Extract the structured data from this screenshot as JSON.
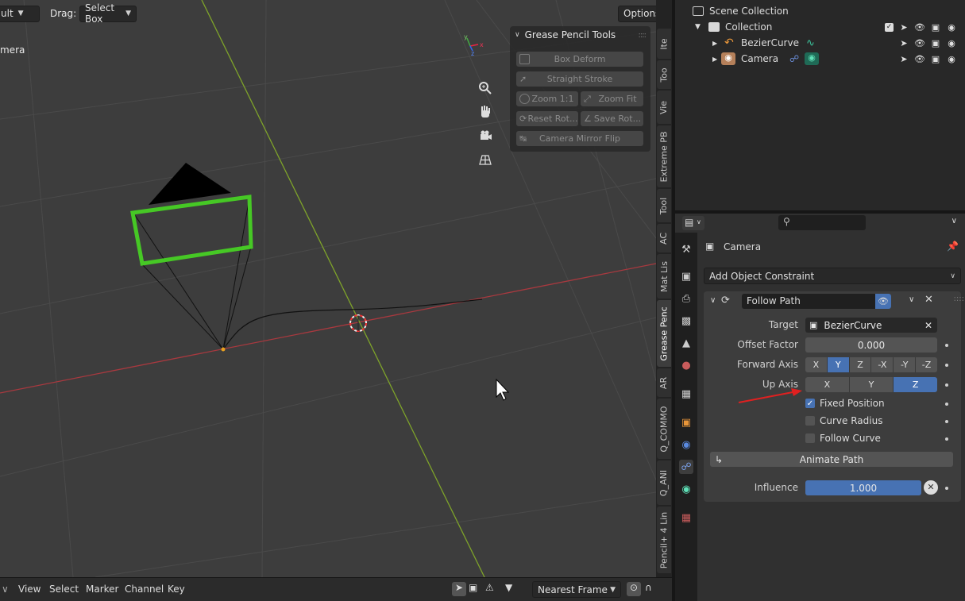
{
  "viewport": {
    "mode_dropdown": "ult",
    "drag_label": "Drag:",
    "drag_value": "Select Box",
    "options_label": "Options",
    "camera_label": "mera"
  },
  "gizmos": [
    "zoom-icon",
    "hand-icon",
    "camera-view-icon",
    "grid-icon"
  ],
  "grease_pencil_panel": {
    "title": "Grease Pencil Tools",
    "buttons": {
      "box_deform": "Box Deform",
      "straight_stroke": "Straight Stroke",
      "zoom_1_1": "Zoom 1:1",
      "zoom_fit": "Zoom Fit",
      "reset_rot": "Reset Rot...",
      "save_rot": "Save Rot...",
      "camera_mirror_flip": "Camera Mirror Flip"
    }
  },
  "sidebar_tabs": {
    "t1": "Ite",
    "t2": "Too",
    "t3": "Vie",
    "t4": "Extreme PB",
    "t5": "Tool",
    "t6": "AC",
    "t7": "Mat Lis",
    "t8": "Grease Penc",
    "t9": "AR",
    "t10": "Q_COMMO",
    "t11": "Q_ANI",
    "t12": "Pencil+ 4 Lin"
  },
  "timeline": {
    "view": "View",
    "select": "Select",
    "marker": "Marker",
    "channel": "Channel",
    "key": "Key",
    "snap_mode": "Nearest Frame"
  },
  "outliner": {
    "scene_collection": "Scene Collection",
    "collection": "Collection",
    "items": {
      "bezier": "BezierCurve",
      "camera": "Camera"
    }
  },
  "properties": {
    "object_name": "Camera",
    "add_constraint": "Add Object Constraint",
    "constraint": {
      "name": "Follow Path",
      "target_label": "Target",
      "target_value": "BezierCurve",
      "offset_label": "Offset Factor",
      "offset_value": "0.000",
      "forward_label": "Forward Axis",
      "forward_options": {
        "x": "X",
        "y": "Y",
        "z": "Z",
        "nx": "-X",
        "ny": "-Y",
        "nz": "-Z"
      },
      "forward_selected": "Y",
      "up_label": "Up Axis",
      "up_options": {
        "x": "X",
        "y": "Y",
        "z": "Z"
      },
      "up_selected": "Z",
      "fixed_position": "Fixed Position",
      "fixed_position_checked": true,
      "curve_radius": "Curve Radius",
      "curve_radius_checked": false,
      "follow_curve": "Follow Curve",
      "follow_curve_checked": false,
      "animate_path": "Animate Path",
      "influence_label": "Influence",
      "influence_value": "1.000"
    }
  },
  "colors": {
    "accent": "#4772b3",
    "x_axis": "#c23b3b",
    "y_axis": "#6d9a2a",
    "selected_frame": "#47c827"
  }
}
